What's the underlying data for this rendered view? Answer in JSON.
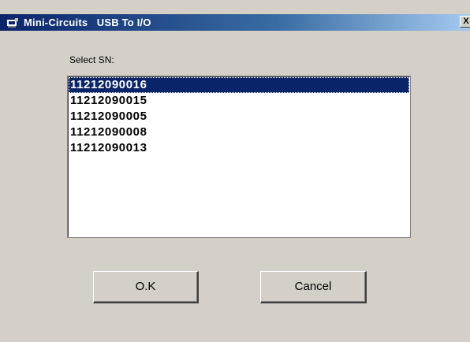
{
  "window": {
    "title": "Mini-Circuits   USB To I/O",
    "close_label": "X",
    "title_icon": "app-icon"
  },
  "form": {
    "select_label": "Select SN:",
    "serial_numbers": [
      "11212090016",
      "11212090015",
      "11212090005",
      "11212090008",
      "11212090013"
    ],
    "selected_index": 0
  },
  "buttons": {
    "ok_label": "O.K",
    "cancel_label": "Cancel"
  },
  "colors": {
    "titlebar_start": "#0a246a",
    "titlebar_end": "#a6caf0",
    "selection": "#0a246a",
    "face": "#d4d0c8"
  }
}
